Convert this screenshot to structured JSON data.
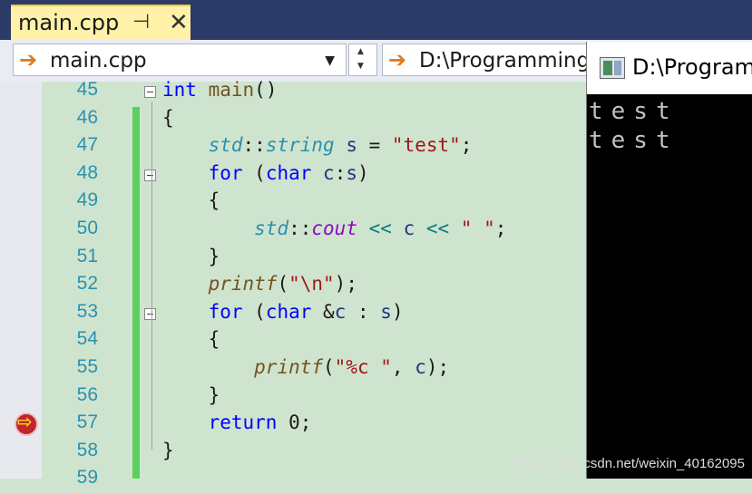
{
  "tab": {
    "title": "main.cpp",
    "pin_icon": "⊣",
    "close_icon": "✕"
  },
  "nav": {
    "file_combo": "main.cpp",
    "scope_combo": "D:\\Programming",
    "arrow_icon": "➔"
  },
  "editor": {
    "lines": [
      {
        "num": "45",
        "fold": true,
        "tokens": [
          [
            "kw",
            "int"
          ],
          [
            "pl",
            " "
          ],
          [
            "fn",
            "main"
          ],
          [
            "pl",
            "()"
          ]
        ]
      },
      {
        "num": "46",
        "fold": false,
        "tokens": [
          [
            "pl",
            "{"
          ]
        ]
      },
      {
        "num": "47",
        "fold": false,
        "tokens": [
          [
            "pl",
            "    "
          ],
          [
            "ty",
            "std"
          ],
          [
            "pl",
            "::"
          ],
          [
            "ty",
            "string"
          ],
          [
            "pl",
            " "
          ],
          [
            "id",
            "s"
          ],
          [
            "pl",
            " = "
          ],
          [
            "st",
            "\"test\""
          ],
          [
            "pl",
            ";"
          ]
        ]
      },
      {
        "num": "48",
        "fold": true,
        "tokens": [
          [
            "pl",
            "    "
          ],
          [
            "kw",
            "for"
          ],
          [
            "pl",
            " ("
          ],
          [
            "kw",
            "char"
          ],
          [
            "pl",
            " "
          ],
          [
            "id",
            "c"
          ],
          [
            "pl",
            ":"
          ],
          [
            "id",
            "s"
          ],
          [
            "pl",
            ")"
          ]
        ]
      },
      {
        "num": "49",
        "fold": false,
        "tokens": [
          [
            "pl",
            "    {"
          ]
        ]
      },
      {
        "num": "50",
        "fold": false,
        "tokens": [
          [
            "pl",
            "        "
          ],
          [
            "ty",
            "std"
          ],
          [
            "pl",
            "::"
          ],
          [
            "it",
            "cout"
          ],
          [
            "pl",
            " "
          ],
          [
            "op",
            "<<"
          ],
          [
            "pl",
            " "
          ],
          [
            "id",
            "c"
          ],
          [
            "pl",
            " "
          ],
          [
            "op",
            "<<"
          ],
          [
            "pl",
            " "
          ],
          [
            "st",
            "\" \""
          ],
          [
            "pl",
            ";"
          ]
        ]
      },
      {
        "num": "51",
        "fold": false,
        "tokens": [
          [
            "pl",
            "    }"
          ]
        ]
      },
      {
        "num": "52",
        "fold": false,
        "tokens": [
          [
            "pl",
            "    "
          ],
          [
            "fnit",
            "printf"
          ],
          [
            "pl",
            "("
          ],
          [
            "st",
            "\"\\n\""
          ],
          [
            "pl",
            ");"
          ]
        ]
      },
      {
        "num": "53",
        "fold": true,
        "tokens": [
          [
            "pl",
            "    "
          ],
          [
            "kw",
            "for"
          ],
          [
            "pl",
            " ("
          ],
          [
            "kw",
            "char"
          ],
          [
            "pl",
            " &"
          ],
          [
            "id",
            "c"
          ],
          [
            "pl",
            " : "
          ],
          [
            "id",
            "s"
          ],
          [
            "pl",
            ")"
          ]
        ]
      },
      {
        "num": "54",
        "fold": false,
        "tokens": [
          [
            "pl",
            "    {"
          ]
        ]
      },
      {
        "num": "55",
        "fold": false,
        "tokens": [
          [
            "pl",
            "        "
          ],
          [
            "fnit",
            "printf"
          ],
          [
            "pl",
            "("
          ],
          [
            "st",
            "\"%c \""
          ],
          [
            "pl",
            ", "
          ],
          [
            "id",
            "c"
          ],
          [
            "pl",
            ");"
          ]
        ]
      },
      {
        "num": "56",
        "fold": false,
        "tokens": [
          [
            "pl",
            "    }"
          ]
        ]
      },
      {
        "num": "57",
        "fold": false,
        "tokens": [
          [
            "pl",
            "    "
          ],
          [
            "kw",
            "return"
          ],
          [
            "pl",
            " 0;"
          ]
        ]
      },
      {
        "num": "58",
        "fold": false,
        "tokens": [
          [
            "pl",
            "}"
          ]
        ]
      },
      {
        "num": "59",
        "fold": false,
        "tokens": []
      }
    ],
    "current_line": "57"
  },
  "console": {
    "title": "D:\\Program",
    "lines": [
      "test",
      "test"
    ]
  },
  "watermark": "https://blog.csdn.net/weixin_40162095"
}
